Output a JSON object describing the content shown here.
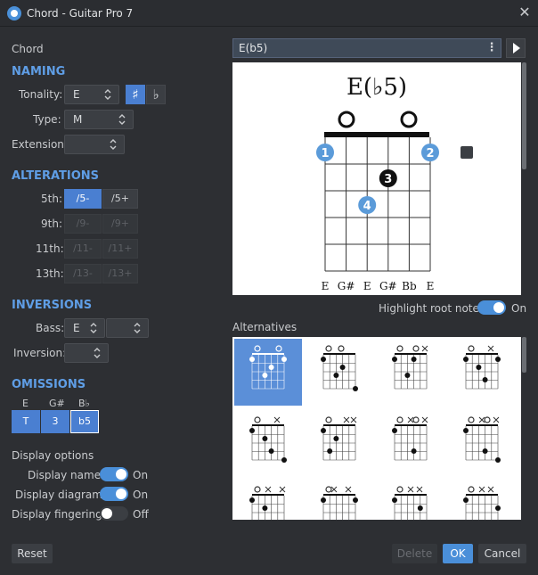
{
  "window": {
    "title": "Chord - Guitar Pro 7"
  },
  "left": {
    "chord_label": "Chord",
    "naming": {
      "header": "NAMING",
      "tonality_label": "Tonality:",
      "tonality_value": "E",
      "sharp": "♯",
      "flat": "♭",
      "type_label": "Type:",
      "type_value": "M",
      "extension_label": "Extension:",
      "extension_value": ""
    },
    "alterations": {
      "header": "ALTERATIONS",
      "rows": [
        {
          "label": "5th:",
          "minus": "/5-",
          "plus": "/5+"
        },
        {
          "label": "9th:",
          "minus": "/9-",
          "plus": "/9+"
        },
        {
          "label": "11th:",
          "minus": "/11-",
          "plus": "/11+"
        },
        {
          "label": "13th:",
          "minus": "/13-",
          "plus": "/13+"
        }
      ]
    },
    "inversions": {
      "header": "INVERSIONS",
      "bass_label": "Bass:",
      "bass_value": "E",
      "bass_value2": "",
      "inversion_label": "Inversion:",
      "inversion_value": ""
    },
    "omissions": {
      "header": "OMISSIONS",
      "notes": [
        {
          "note": "E",
          "btn": "T"
        },
        {
          "note": "G#",
          "btn": "3"
        },
        {
          "note": "B♭",
          "btn": "b5"
        }
      ]
    },
    "display": {
      "header": "Display options",
      "name_label": "Display name:",
      "name_state": "On",
      "diagram_label": "Display diagram:",
      "diagram_state": "On",
      "fingering_label": "Display fingering:",
      "fingering_state": "Off"
    }
  },
  "right": {
    "chord_name": "E(b5)",
    "diagram_title": "E(♭5)",
    "notes": [
      "E",
      "G#",
      "E",
      "G#",
      "Bb",
      "E"
    ],
    "highlight_label": "Highlight root note:",
    "highlight_state": "On",
    "alternatives_label": "Alternatives"
  },
  "footer": {
    "reset": "Reset",
    "delete": "Delete",
    "ok": "OK",
    "cancel": "Cancel"
  },
  "colors": {
    "accent": "#4a8fd9",
    "section": "#5f9ee6",
    "finger": "#5b9bd9"
  }
}
